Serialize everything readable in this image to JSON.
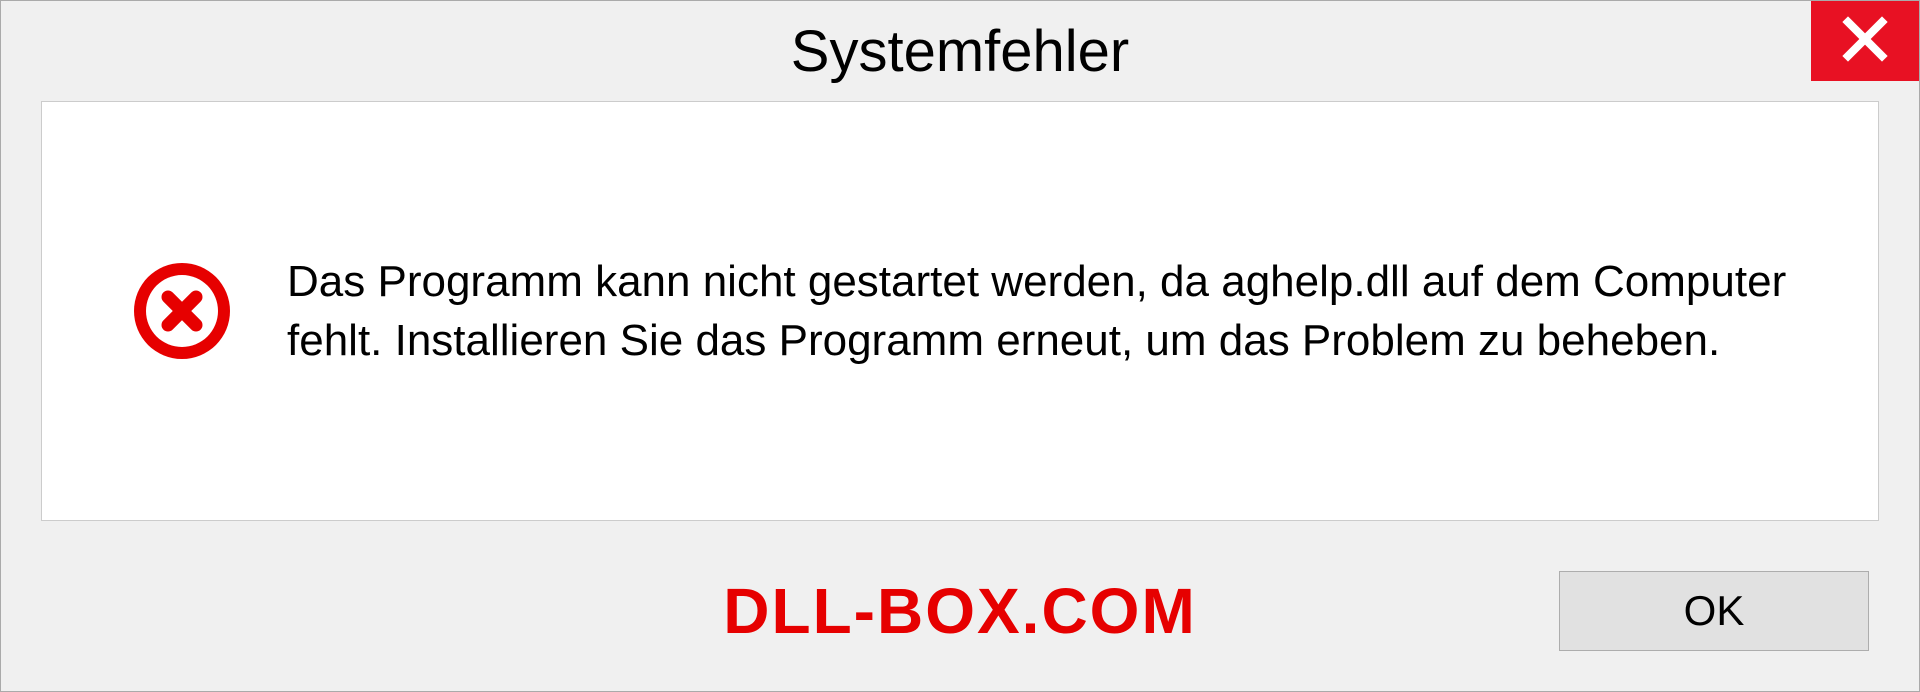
{
  "dialog": {
    "title": "Systemfehler",
    "message": "Das Programm kann nicht gestartet werden, da aghelp.dll auf dem Computer fehlt. Installieren Sie das Programm erneut, um das Problem zu beheben.",
    "ok_label": "OK"
  },
  "watermark": "DLL-BOX.COM",
  "colors": {
    "close_bg": "#e81123",
    "error_red": "#e60000",
    "panel_bg": "#f0f0f0"
  },
  "icons": {
    "close": "close-icon",
    "error": "error-circle-x-icon"
  }
}
